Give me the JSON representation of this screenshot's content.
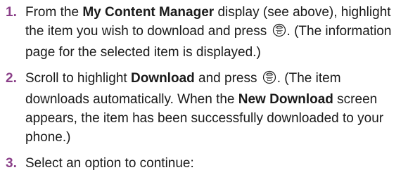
{
  "steps": [
    {
      "number": "1.",
      "t1": "From the ",
      "b1": "My Content Manager",
      "t2": " display (see above), highlight the item you wish to download and press ",
      "t3": ". (The information page for the selected item is displayed.)"
    },
    {
      "number": "2.",
      "t1": "Scroll to highlight ",
      "b1": "Download",
      "t2": " and press ",
      "t3": ". (The item downloads automatically. When the ",
      "b2": "New Download",
      "t4": " screen appears, the item has been successfully downloaded to your phone.)"
    },
    {
      "number": "3.",
      "t1": "Select an option to continue:"
    }
  ],
  "icons": {
    "menu_ok_key": "menu-ok-key-icon"
  },
  "colors": {
    "step_number": "#8a3f88",
    "text": "#1a1a1a"
  }
}
